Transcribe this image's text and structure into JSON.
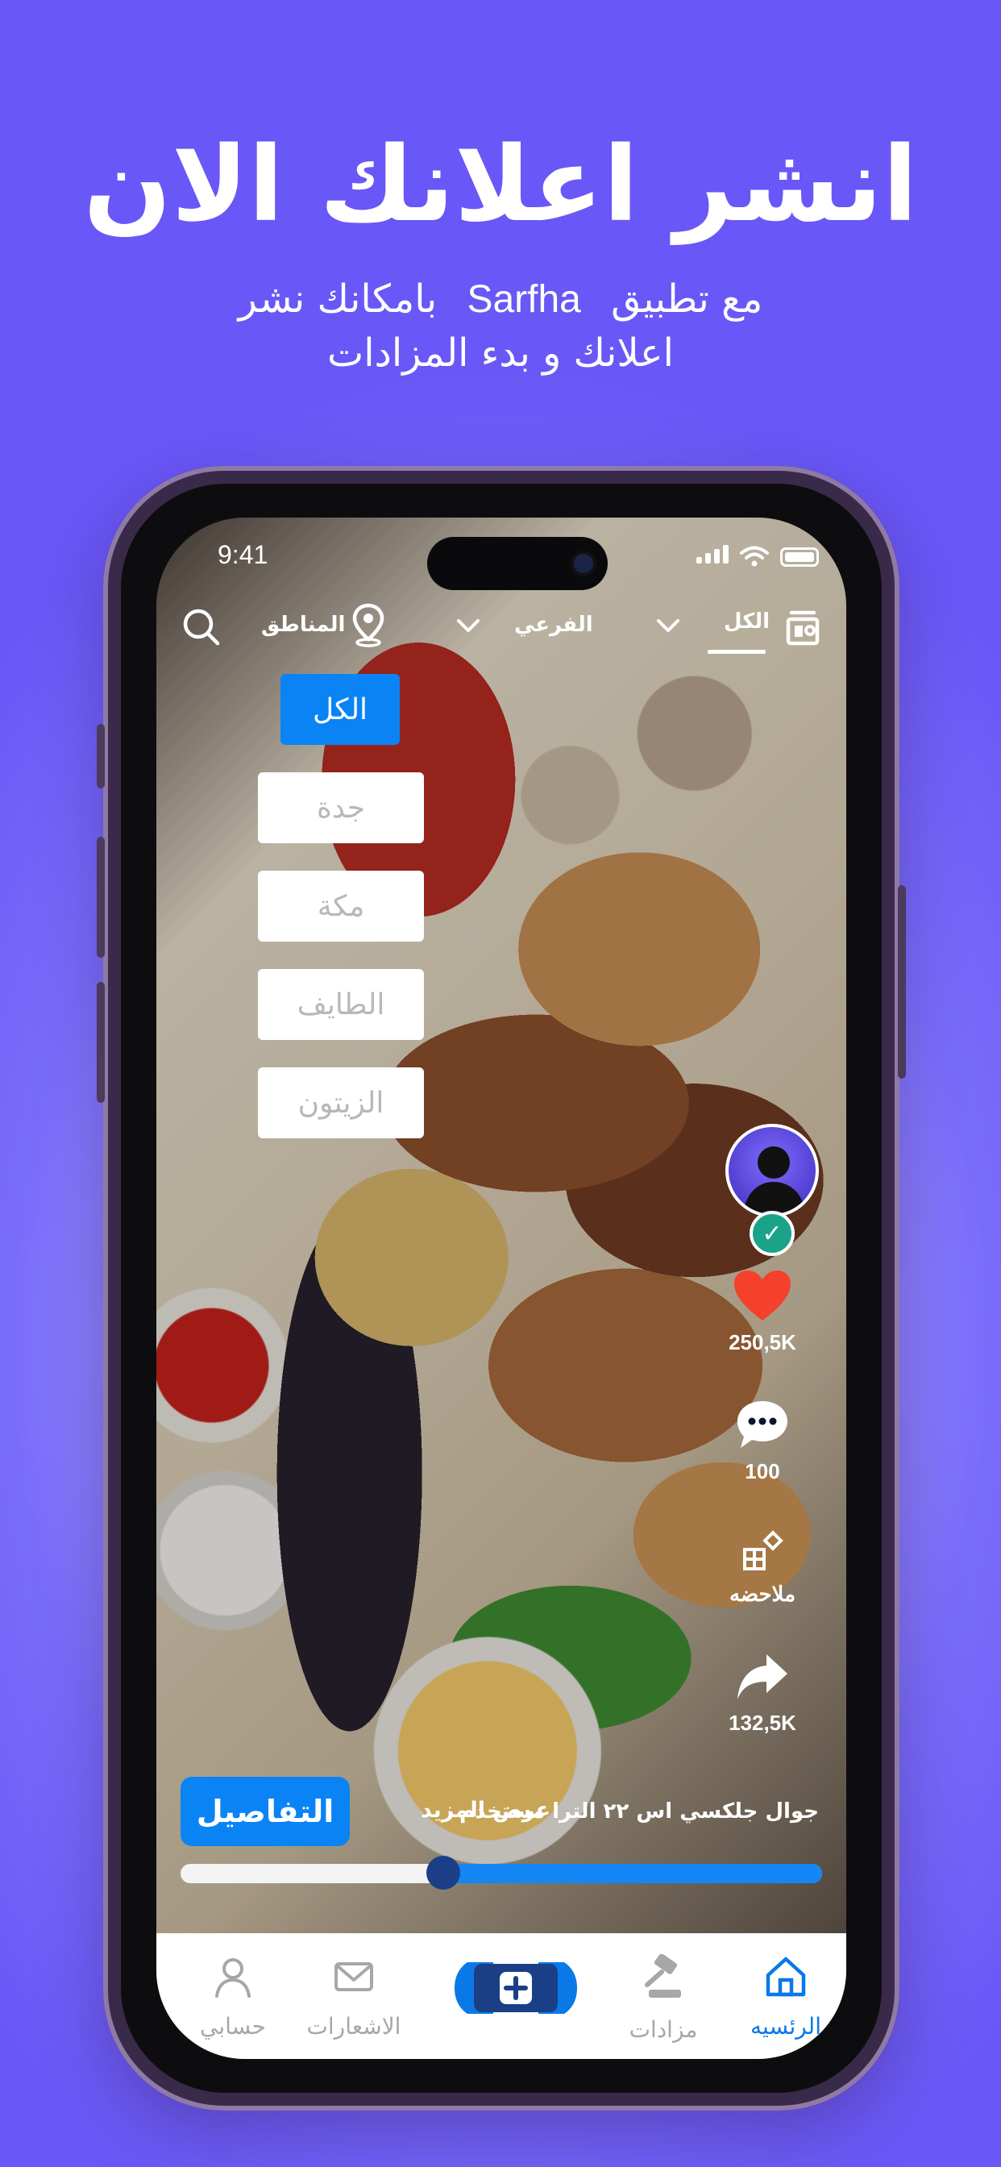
{
  "promo": {
    "headline": "انشر اعلانك الان",
    "subtitle_part1": "مع تطبيق",
    "brand": "Sarfha",
    "subtitle_part2": "بامكانك نشر",
    "subtitle_line2": "اعلانك و بدء المزادات"
  },
  "status_bar": {
    "time": "9:41"
  },
  "top_bar": {
    "regions_label": "المناطق",
    "subcategory_label": "الفرعي",
    "all_label": "الكل"
  },
  "region_filter": {
    "selected": "الكل",
    "options": [
      "جدة",
      "مكة",
      "الطايف",
      "الزيتون"
    ]
  },
  "actions": {
    "likes": "250,5K",
    "comments": "100",
    "note_label": "ملاحضه",
    "shares": "132,5K"
  },
  "post": {
    "description": "جوال جلكسي اس ٢٢ الترا مستخدم",
    "more_label": "عرض المزيد",
    "details_button": "التفاصيل",
    "progress": 0.41
  },
  "bottom_nav": {
    "home": "الرئسيه",
    "auctions": "مزادات",
    "notifications": "الاشعارات",
    "account": "حسابي"
  },
  "colors": {
    "accent": "#0a84f4",
    "background": "#6a57f7",
    "like": "#f5402c",
    "verified": "#1aa389"
  }
}
